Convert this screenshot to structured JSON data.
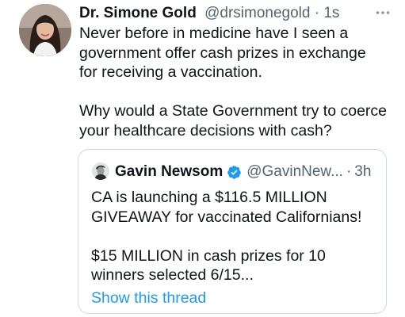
{
  "tweet": {
    "author_name": "Dr. Simone Gold",
    "author_handle": "@drsimonegold",
    "separator": "·",
    "time": "1s",
    "text": "Never before in medicine have I seen a\ngovernment offer cash prizes in exchange\nfor receiving a vaccination.\n\nWhy would a State Government try to coerce\nyour healthcare decisions with cash?",
    "avatar_icon": "profile-photo",
    "more_icon": "more-horizontal-icon"
  },
  "quoted": {
    "author_name": "Gavin Newsom",
    "author_handle": "@GavinNew...",
    "separator": "·",
    "time": "3h",
    "verified_icon": "verified-badge-icon",
    "text": "CA is launching a $116.5 MILLION\nGIVEAWAY for vaccinated Californians!\n\n$15 MILLION in cash prizes for 10\nwinners selected 6/15...",
    "show_thread_label": "Show this thread"
  },
  "colors": {
    "text": "#0f1419",
    "secondary": "#536471",
    "link": "#1d9bf0",
    "border": "#cfd9de"
  }
}
